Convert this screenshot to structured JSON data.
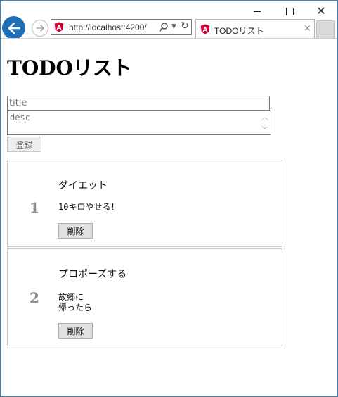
{
  "window": {
    "controls": {
      "minimize": "—",
      "maximize": "☐",
      "close": "✕"
    }
  },
  "browser": {
    "address": "http://localhost:4200/",
    "tab_title": "TODOリスト",
    "tab_close": "×",
    "accent_color": "#1e6fb8",
    "favicon_color": "#dd0031",
    "favicon_letter": "A"
  },
  "page": {
    "title": "TODOリスト",
    "form": {
      "title_placeholder": "title",
      "title_value": "",
      "desc_placeholder": "desc",
      "desc_value": "",
      "register_label": "登録"
    },
    "todos": [
      {
        "number": "1",
        "title": "ダイエット",
        "desc": "10キロやせる！",
        "delete_label": "削除"
      },
      {
        "number": "2",
        "title": "プロポーズする",
        "desc": "故郷に\n帰ったら",
        "delete_label": "削除"
      }
    ]
  }
}
